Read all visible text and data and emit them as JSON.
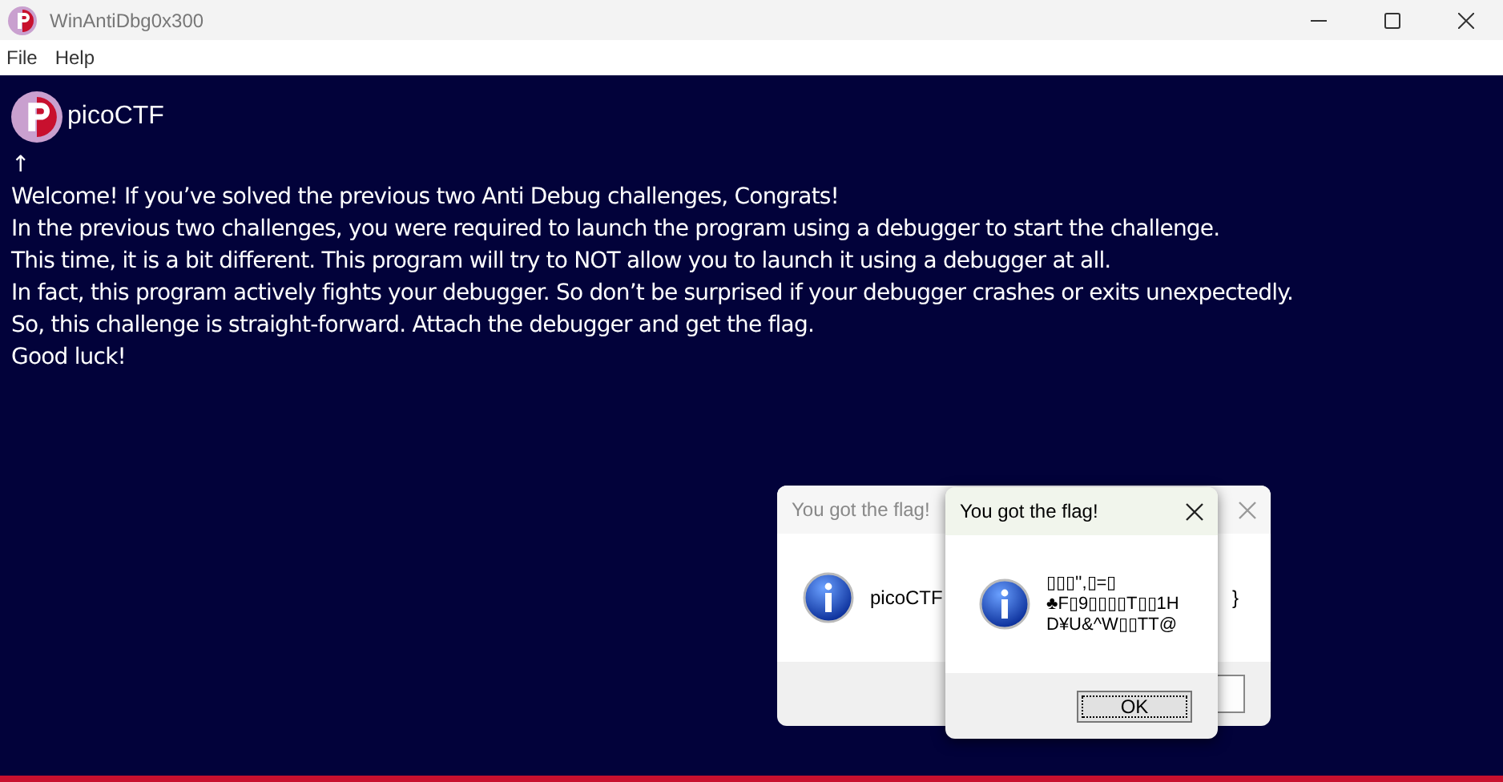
{
  "window": {
    "title": "WinAntiDbg0x300"
  },
  "menu": [
    "File",
    "Help"
  ],
  "brand": {
    "name": "picoCTF"
  },
  "body_lines": [
    "↑",
    "Welcome! If you’ve solved the previous two Anti Debug challenges, Congrats!",
    "In the previous two challenges, you were required to launch the program using a debugger to start the challenge.",
    "This time, it is a bit different. This program will try to NOT allow you to launch it using a debugger at all.",
    "In fact, this program actively fights your debugger. So don’t be surprised if your debugger crashes or exits unexpectedly.",
    "So, this challenge is straight-forward. Attach the debugger and get the flag.",
    "Good luck!"
  ],
  "dialogs": [
    {
      "title": "You got the flag!",
      "active": false,
      "message": [
        "picoCTF"
      ],
      "message_end": "}"
    },
    {
      "title": "You got the flag!",
      "active": true,
      "message": [
        "▯▯▯'',▯=▯",
        "♣F▯9▯▯▯▯T▯▯1H",
        "D¥U&^W▯▯TT@"
      ],
      "button": "OK"
    }
  ]
}
